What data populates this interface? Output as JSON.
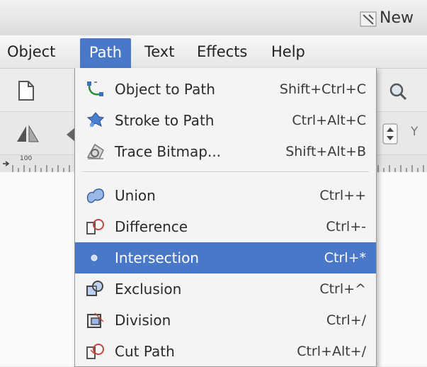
{
  "window": {
    "title": "New"
  },
  "menubar": {
    "items": [
      {
        "label": "Object"
      },
      {
        "label": "Path",
        "active": true
      },
      {
        "label": "Text"
      },
      {
        "label": "Effects"
      },
      {
        "label": "Help"
      }
    ]
  },
  "ruler": {
    "label": "100"
  },
  "toolbar": {
    "y_label": "Y"
  },
  "path_menu": {
    "items": [
      {
        "label": "Object to Path",
        "shortcut": "Shift+Ctrl+C",
        "icon": "object-to-path-icon"
      },
      {
        "label": "Stroke to Path",
        "shortcut": "Ctrl+Alt+C",
        "icon": "stroke-to-path-icon"
      },
      {
        "label": "Trace Bitmap...",
        "shortcut": "Shift+Alt+B",
        "icon": "trace-bitmap-icon"
      },
      {
        "label": "Union",
        "shortcut": "Ctrl++",
        "icon": "union-icon"
      },
      {
        "label": "Difference",
        "shortcut": "Ctrl+-",
        "icon": "difference-icon"
      },
      {
        "label": "Intersection",
        "shortcut": "Ctrl+*",
        "icon": "intersection-icon",
        "highlighted": true
      },
      {
        "label": "Exclusion",
        "shortcut": "Ctrl+^",
        "icon": "exclusion-icon"
      },
      {
        "label": "Division",
        "shortcut": "Ctrl+/",
        "icon": "division-icon"
      },
      {
        "label": "Cut Path",
        "shortcut": "Ctrl+Alt+/",
        "icon": "cut-path-icon"
      }
    ]
  },
  "colors": {
    "highlight": "#4a78c8",
    "menu_background": "#f4f4f4"
  }
}
